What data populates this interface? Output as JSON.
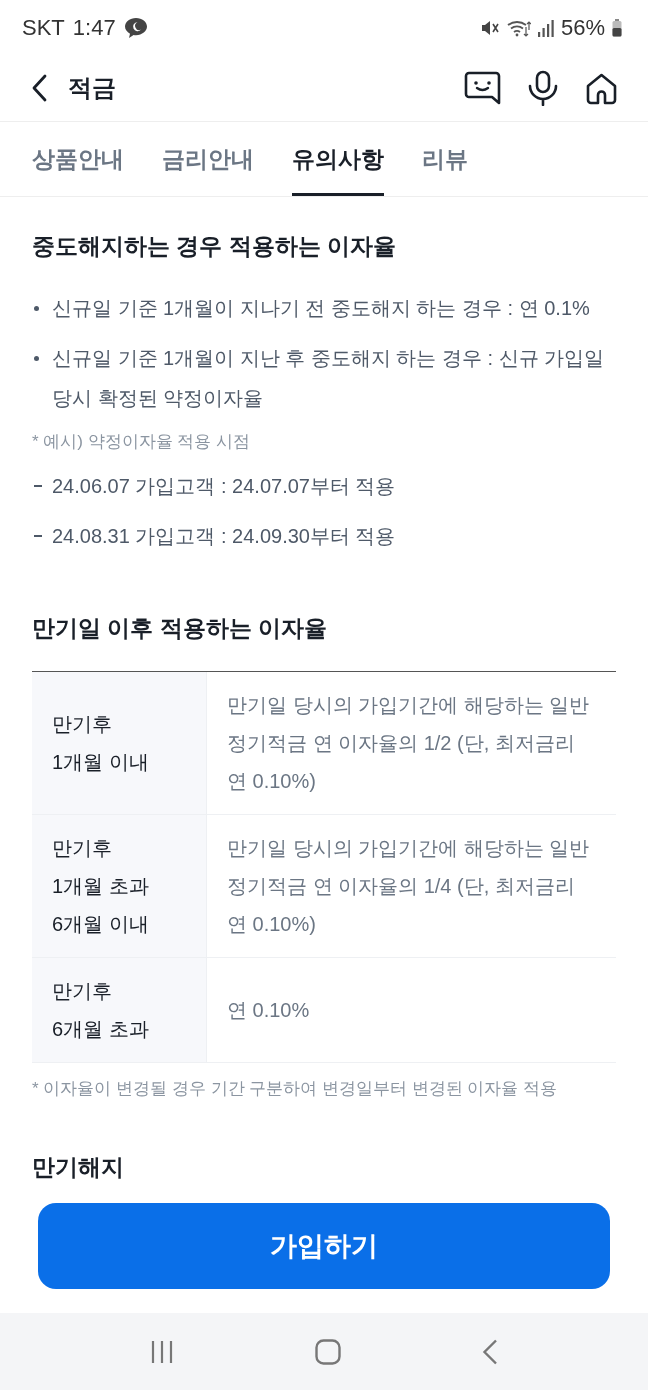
{
  "status_bar": {
    "carrier": "SKT",
    "time": "1:47",
    "battery": "56%"
  },
  "header": {
    "title": "적금"
  },
  "tabs": [
    {
      "label": "상품안내",
      "selected": false
    },
    {
      "label": "금리안내",
      "selected": false
    },
    {
      "label": "유의사항",
      "selected": true
    },
    {
      "label": "리뷰",
      "selected": false
    }
  ],
  "sections": [
    {
      "title": "중도해지하는 경우 적용하는 이자율",
      "items": [
        {
          "kind": "bullet",
          "text": "신규일 기준 1개월이 지나기 전 중도해지 하는 경우 : 연 0.1%"
        },
        {
          "kind": "bullet",
          "text": "신규일 기준 1개월이 지난 후 중도해지 하는 경우 : 신규 가입일 당시 확정된 약정이자율"
        },
        {
          "kind": "note",
          "text": "* 예시) 약정이자율 적용 시점"
        },
        {
          "kind": "dash",
          "text": "24.06.07 가입고객 : 24.07.07부터 적용"
        },
        {
          "kind": "dash",
          "text": "24.08.31 가입고객 : 24.09.30부터 적용"
        }
      ]
    },
    {
      "title": "만기일 이후 적용하는 이자율",
      "table": {
        "rows": [
          {
            "period": "만기후\n1개월 이내",
            "rate": "만기일 당시의 가입기간에 해당하는 일반 정기적금 연 이자율의 1/2 (단, 최저금리 연 0.10%)"
          },
          {
            "period": "만기후\n1개월 초과\n6개월 이내",
            "rate": "만기일 당시의 가입기간에 해당하는 일반 정기적금 연 이자율의 1/4 (단, 최저금리 연 0.10%)"
          },
          {
            "period": "만기후\n6개월 초과",
            "rate": "연 0.10%"
          }
        ]
      },
      "items": [
        {
          "kind": "note",
          "text": "* 이자율이 변경될 경우 기간 구분하여 변경일부터 변경된 이자율 적용"
        }
      ]
    },
    {
      "title": "만기해지"
    }
  ],
  "join_button": {
    "label": "가입하기"
  }
}
